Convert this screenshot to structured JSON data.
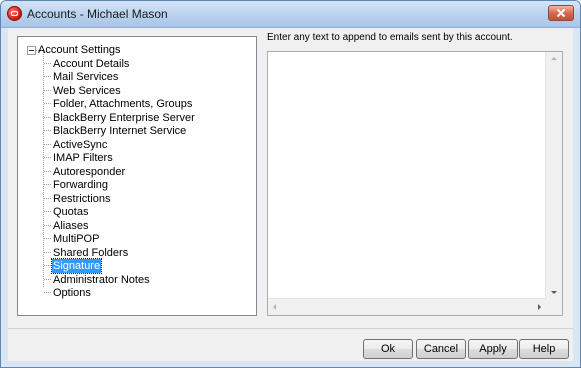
{
  "window": {
    "title": "Accounts - Michael Mason",
    "app_icon": "mdaemon-app-icon",
    "close_icon": "close-icon"
  },
  "tree": {
    "root_label": "Account Settings",
    "root_expanded": true,
    "items": [
      {
        "label": "Account Details"
      },
      {
        "label": "Mail Services"
      },
      {
        "label": "Web Services"
      },
      {
        "label": "Folder, Attachments, Groups"
      },
      {
        "label": "BlackBerry Enterprise Server"
      },
      {
        "label": "BlackBerry Internet Service"
      },
      {
        "label": "ActiveSync"
      },
      {
        "label": "IMAP Filters"
      },
      {
        "label": "Autoresponder"
      },
      {
        "label": "Forwarding"
      },
      {
        "label": "Restrictions"
      },
      {
        "label": "Quotas"
      },
      {
        "label": "Aliases"
      },
      {
        "label": "MultiPOP"
      },
      {
        "label": "Shared Folders"
      },
      {
        "label": "Signature",
        "selected": true
      },
      {
        "label": "Administrator Notes"
      },
      {
        "label": "Options"
      }
    ]
  },
  "signature_panel": {
    "description": "Enter any text to append to emails sent by this account.",
    "text_value": ""
  },
  "buttons": {
    "ok": "Ok",
    "cancel": "Cancel",
    "apply": "Apply",
    "help": "Help"
  },
  "colors": {
    "selection": "#3399ff",
    "titlebar": "#b9d1ee",
    "close_button": "#c24f35"
  }
}
